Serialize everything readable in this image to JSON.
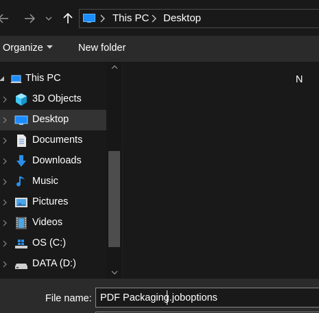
{
  "address_bar": {
    "path": [
      "This PC",
      "Desktop"
    ],
    "icons": {
      "back": "arrow-left-icon",
      "forward": "arrow-right-icon",
      "recent": "chevron-down-icon",
      "up": "arrow-up-icon",
      "location": "monitor-icon"
    }
  },
  "toolbar": {
    "organize_label": "Organize",
    "new_folder_label": "New folder"
  },
  "nav_tree": {
    "root_label": "This PC",
    "items": [
      {
        "label": "3D Objects",
        "icon": "cube-icon"
      },
      {
        "label": "Desktop",
        "icon": "desktop-icon",
        "selected": true
      },
      {
        "label": "Documents",
        "icon": "document-icon"
      },
      {
        "label": "Downloads",
        "icon": "download-arrow-icon"
      },
      {
        "label": "Music",
        "icon": "music-note-icon"
      },
      {
        "label": "Pictures",
        "icon": "picture-icon"
      },
      {
        "label": "Videos",
        "icon": "film-icon"
      },
      {
        "label": "OS (C:)",
        "icon": "windows-drive-icon"
      },
      {
        "label": "DATA (D:)",
        "icon": "drive-icon"
      }
    ]
  },
  "content": {
    "column_header_visible": "N"
  },
  "footer": {
    "file_name_label": "File name:",
    "file_name_value": "PDF Packaging.joboptions"
  },
  "colors": {
    "background": "#191919",
    "toolbar": "#2b2b2b",
    "selection": "#333333",
    "accent_blue": "#1e90ff"
  }
}
